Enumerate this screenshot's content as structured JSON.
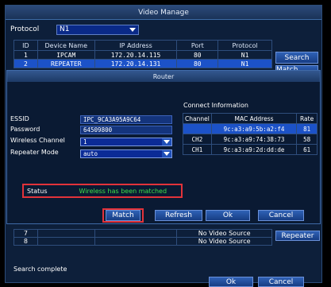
{
  "video_manage": {
    "title": "Video Manage",
    "protocol_label": "Protocol",
    "protocol_value": "N1",
    "columns": [
      "ID",
      "Device Name",
      "IP Address",
      "Port",
      "Protocol"
    ],
    "rows": [
      {
        "id": "1",
        "name": "IPCAM",
        "ip": "172.20.14.115",
        "port": "80",
        "protocol": "N1"
      },
      {
        "id": "2",
        "name": "REPEATER",
        "ip": "172.20.14.131",
        "port": "80",
        "protocol": "N1"
      }
    ],
    "search_label": "Search",
    "match_code_label": "Match Code",
    "lower_rows": [
      {
        "id": "7",
        "source": "No Video Source"
      },
      {
        "id": "8",
        "source": "No Video Source"
      }
    ],
    "repeater_label": "Repeater",
    "status_text": "Search complete",
    "ok_label": "Ok",
    "cancel_label": "Cancel"
  },
  "router": {
    "title": "Router",
    "essid_label": "ESSID",
    "essid_value": "IPC_9CA3A95A9C64",
    "password_label": "Password",
    "password_value": "64509800",
    "channel_label": "Wireless Channel",
    "channel_value": "1",
    "mode_label": "Repeater Mode",
    "mode_value": "auto",
    "connect_info_title": "Connect Information",
    "ci_columns": [
      "Channel",
      "MAC Address",
      "Rate"
    ],
    "ci_rows": [
      {
        "channel": "",
        "mac": "9c:a3:a9:5b:a2:f4",
        "rate": "81"
      },
      {
        "channel": "CH2",
        "mac": "9c:a3:a9:74:38:73",
        "rate": "58"
      },
      {
        "channel": "CH1",
        "mac": "9c:a3:a9:2d:dd:de",
        "rate": "61"
      }
    ],
    "status_label": "Status",
    "status_value": "Wireless has been matched",
    "match_label": "Match",
    "refresh_label": "Refresh",
    "ok_label": "Ok",
    "cancel_label": "Cancel"
  },
  "colors": {
    "selected_row": "#1c52c8",
    "status_ok": "#3fe04a",
    "highlight_outline": "#e2333a"
  }
}
